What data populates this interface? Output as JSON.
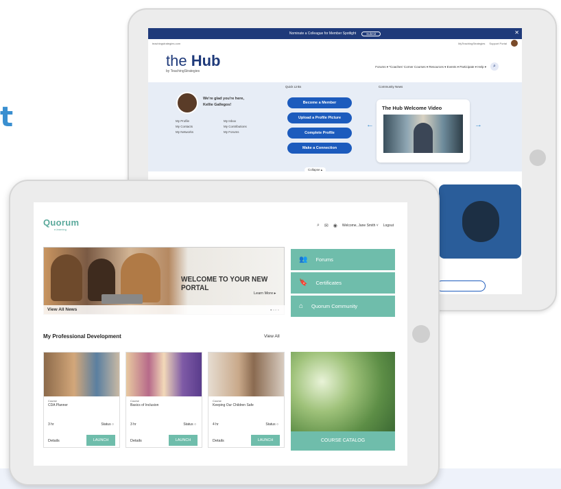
{
  "background": {
    "heading_fragment": "t",
    "accent": "#3a8fd0"
  },
  "hub": {
    "banner_text": "Nominate a Colleague for Member Spotlight",
    "banner_button": "Submit",
    "close": "✕",
    "util_left": "teachingstrategies.com",
    "util_right": [
      "MyTeachingStrategies",
      "Support Portal"
    ],
    "logo_the": "the",
    "logo_hub": "Hub",
    "logo_by": "by TeachingStrategies",
    "nav": "Forums ▾  *Coaches' Corner  Courses ▾  Resources ▾  Events ▾  Participate ▾  Help ▾",
    "welcome": "We're glad you're here, Kellie Gallegos!",
    "links": [
      "My Profile",
      "My Inbox",
      "My Contacts",
      "My Contributions",
      "My Networks",
      "My Forums"
    ],
    "quick_links_label": "Quick Links",
    "quick_buttons": [
      "Become a Member",
      "Upload a Profile Picture",
      "Complete Profile",
      "Make a Connection"
    ],
    "community_label": "Community News",
    "video_title": "The Hub Welcome Video",
    "collapse": "Collapse ▴"
  },
  "quorum": {
    "logo": "Quorum",
    "logo_sub": "e-learning",
    "welcome_user": "Welcome, Jane Smith ˅",
    "logout": "Logout",
    "banner_headline": "WELCOME TO YOUR NEW PORTAL",
    "learn_more": "Learn More ▸",
    "view_all_news": "View All News",
    "pager": "● ○ ○ ○",
    "tiles": [
      {
        "label": "Forums",
        "icon": "users-icon",
        "glyph": "👥"
      },
      {
        "label": "Certificates",
        "icon": "bookmark-icon",
        "glyph": "🔖"
      },
      {
        "label": "Quorum Community",
        "icon": "home-icon",
        "glyph": "⌂"
      }
    ],
    "section_title": "My Professional Development",
    "view_all": "View All",
    "courses": [
      {
        "kind": "Course",
        "name": "CDA Planner",
        "hours": "3 hr",
        "status": "Status ○",
        "details": "Details",
        "launch": "LAUNCH"
      },
      {
        "kind": "Course",
        "name": "Basics of Inclusion",
        "hours": "3 hr",
        "status": "Status ○",
        "details": "Details",
        "launch": "LAUNCH"
      },
      {
        "kind": "Course",
        "name": "Keeping Our Children Safe",
        "hours": "4 hr",
        "status": "Status ○",
        "details": "Details",
        "launch": "LAUNCH"
      }
    ],
    "catalog": "COURSE CATALOG",
    "accent": "#6fbdab"
  }
}
